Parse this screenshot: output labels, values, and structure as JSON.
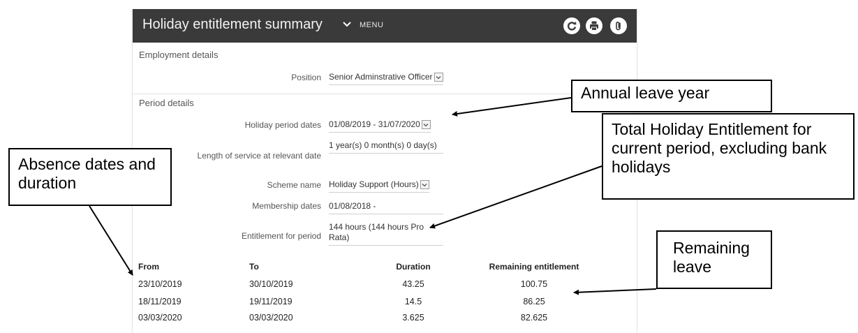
{
  "app": {
    "title": "Holiday entitlement summary",
    "menu_label": "MENU",
    "toolbar_icons": [
      "refresh-icon",
      "print-icon",
      "attachment-icon"
    ]
  },
  "employment": {
    "section_title": "Employment details",
    "position_label": "Position",
    "position_value": "Senior Adminstrative Officer"
  },
  "period": {
    "section_title": "Period details",
    "holiday_dates_label": "Holiday period dates",
    "holiday_dates_value": "01/08/2019 - 31/07/2020",
    "service_label": "Length of service at relevant date",
    "service_value": "1 year(s) 0 month(s) 0 day(s)",
    "scheme_label": "Scheme name",
    "scheme_value": "Holiday Support (Hours)",
    "membership_label": "Membership dates",
    "membership_value": "01/08/2018 -",
    "entitlement_label": "Entitlement for period",
    "entitlement_value": "144 hours (144 hours Pro Rata)"
  },
  "absence_table": {
    "headers": [
      "From",
      "To",
      "Duration",
      "Remaining entitlement"
    ],
    "rows": [
      [
        "23/10/2019",
        "30/10/2019",
        "43.25",
        "100.75"
      ],
      [
        "18/11/2019",
        "19/11/2019",
        "14.5",
        "86.25"
      ],
      [
        "03/03/2020",
        "03/03/2020",
        "3.625",
        "82.625"
      ]
    ]
  },
  "callouts": {
    "annual_leave": "Annual leave year",
    "total_entitlement": "Total Holiday Entitlement for current period, excluding bank holidays",
    "absence": "Absence dates and duration",
    "remaining": "Remaining leave"
  },
  "colors": {
    "topbar": "#3a3a3a",
    "text": "#333333",
    "label": "#555555"
  }
}
